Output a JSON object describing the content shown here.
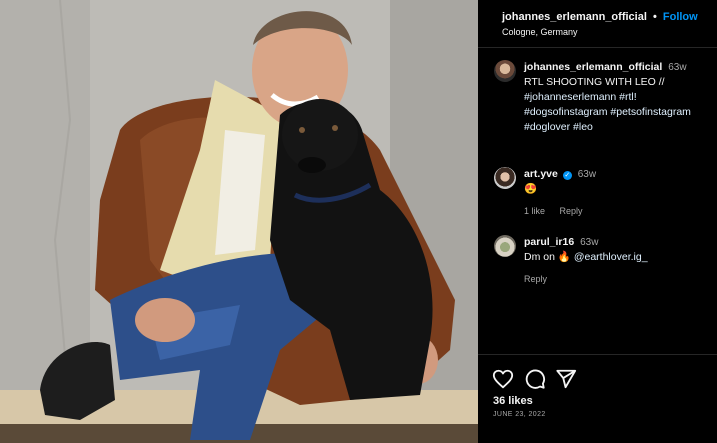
{
  "header": {
    "username": "johannes_erlemann_official",
    "separator": "•",
    "follow_label": "Follow",
    "location": "Cologne, Germany"
  },
  "caption": {
    "username": "johannes_erlemann_official",
    "time": "63w",
    "text": "RTL SHOOTING WITH LEO //",
    "hashtags": "#johanneserlemann #rtl! #dogsofinstagram #petsofinstagram #doglover #leo"
  },
  "comments": [
    {
      "username": "art.yve",
      "verified_mark": "✓",
      "time": "63w",
      "text": "😍",
      "likes": "1 like",
      "reply_label": "Reply"
    },
    {
      "username": "parul_ir16",
      "time": "63w",
      "text_prefix": "Dm on 🔥",
      "mention": "@earthlover.ig_",
      "reply_label": "Reply"
    }
  ],
  "footer": {
    "likes": "36 likes",
    "date": "JUNE 23, 2022"
  },
  "icons": {
    "like": "heart-icon",
    "comment": "comment-icon",
    "share": "share-icon"
  },
  "colors": {
    "accent": "#0095f6",
    "hashtag": "#e0f1ff",
    "secondary_text": "#a8a8a8",
    "background": "#000000"
  }
}
